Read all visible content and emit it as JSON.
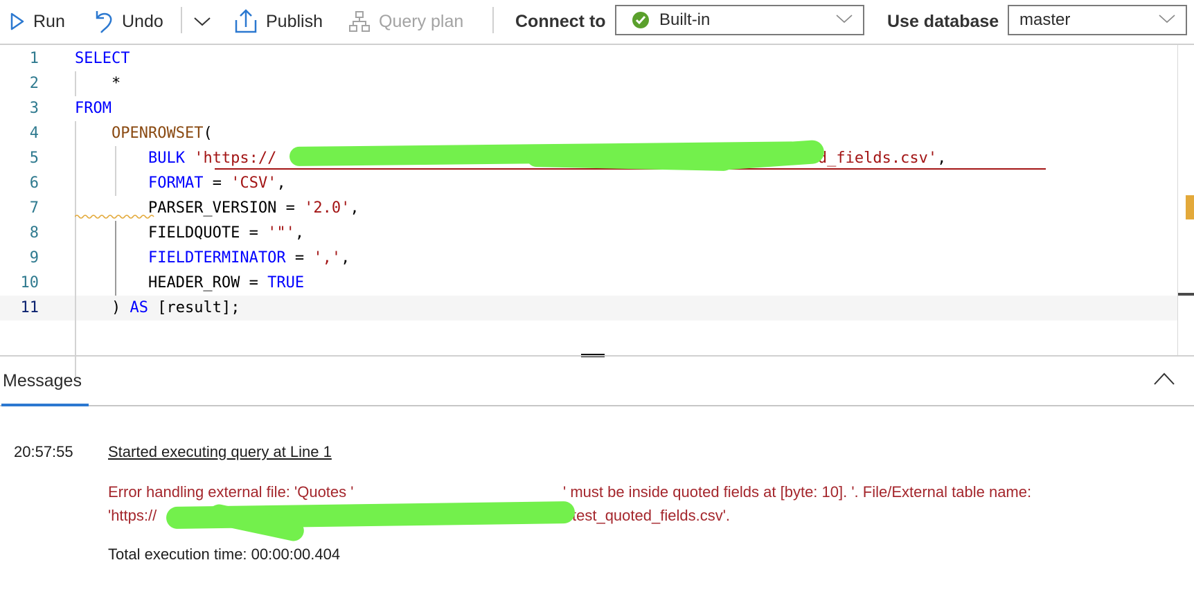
{
  "toolbar": {
    "run_label": "Run",
    "undo_label": "Undo",
    "publish_label": "Publish",
    "query_plan_label": "Query plan",
    "connect_to_label": "Connect to",
    "connect_to_value": "Built-in",
    "use_database_label": "Use database",
    "use_database_value": "master"
  },
  "icons": {
    "run": "play-icon",
    "undo": "undo-icon",
    "more": "chevron-down-icon",
    "publish": "upload-icon",
    "query_plan": "hierarchy-icon",
    "connected": "check-circle-icon",
    "collapse": "chevron-up-icon"
  },
  "colors": {
    "accent": "#2b78d0",
    "keyword": "#0000ff",
    "function": "#795e26",
    "string": "#a31515",
    "error": "#a4262c",
    "connected": "#5aa02c",
    "warning": "#e3a93a"
  },
  "editor": {
    "lines": [
      {
        "n": "1",
        "tokens": [
          {
            "t": "SELECT",
            "c": "kw"
          }
        ]
      },
      {
        "n": "2",
        "tokens": [
          {
            "t": "    *",
            "c": "plain"
          }
        ]
      },
      {
        "n": "3",
        "tokens": [
          {
            "t": "FROM",
            "c": "kw"
          }
        ]
      },
      {
        "n": "4",
        "tokens": [
          {
            "t": "    ",
            "c": "plain"
          },
          {
            "t": "OPENROWSET",
            "c": "fn2"
          },
          {
            "t": "(",
            "c": "plain"
          }
        ]
      },
      {
        "n": "5",
        "tokens": [
          {
            "t": "        ",
            "c": "plain"
          },
          {
            "t": "BULK",
            "c": "kw"
          },
          {
            "t": " ",
            "c": "plain"
          },
          {
            "t": "'https://",
            "c": "str"
          },
          {
            "t": "                                                ",
            "c": "str"
          },
          {
            "t": "/test_quoted_fields.csv'",
            "c": "str"
          },
          {
            "t": ",",
            "c": "plain"
          }
        ]
      },
      {
        "n": "6",
        "tokens": [
          {
            "t": "        ",
            "c": "plain"
          },
          {
            "t": "FORMAT",
            "c": "kw"
          },
          {
            "t": " = ",
            "c": "plain"
          },
          {
            "t": "'CSV'",
            "c": "str"
          },
          {
            "t": ",",
            "c": "plain"
          }
        ]
      },
      {
        "n": "7",
        "tokens": [
          {
            "t": "        PARSER_VERSION = ",
            "c": "plain"
          },
          {
            "t": "'2.0'",
            "c": "str"
          },
          {
            "t": ",",
            "c": "plain"
          }
        ]
      },
      {
        "n": "8",
        "tokens": [
          {
            "t": "        FIELDQUOTE = ",
            "c": "plain"
          },
          {
            "t": "'\"'",
            "c": "str"
          },
          {
            "t": ",",
            "c": "plain"
          }
        ]
      },
      {
        "n": "9",
        "tokens": [
          {
            "t": "        ",
            "c": "plain"
          },
          {
            "t": "FIELDTERMINATOR",
            "c": "kw"
          },
          {
            "t": " = ",
            "c": "plain"
          },
          {
            "t": "','",
            "c": "str"
          },
          {
            "t": ",",
            "c": "plain"
          }
        ]
      },
      {
        "n": "10",
        "tokens": [
          {
            "t": "        HEADER_ROW = ",
            "c": "plain"
          },
          {
            "t": "TRUE",
            "c": "kw"
          }
        ]
      },
      {
        "n": "11",
        "tokens": [
          {
            "t": "    ) ",
            "c": "plain"
          },
          {
            "t": "AS",
            "c": "kw"
          },
          {
            "t": " [result];",
            "c": "plain"
          }
        ]
      }
    ],
    "current_line": "11"
  },
  "messages": {
    "tab_label": "Messages",
    "timestamp": "20:57:55",
    "started_text": "Started executing query at Line 1",
    "error_line1_a": "Error handling external file: 'Quotes '",
    "error_line1_b": "' must be inside quoted fields at [byte: 10]. '. File/External table name:",
    "error_line2_a": "'https://",
    "error_line2_b": "test_quoted_fields.csv'.",
    "total_time": "Total execution time: 00:00:00.404"
  }
}
